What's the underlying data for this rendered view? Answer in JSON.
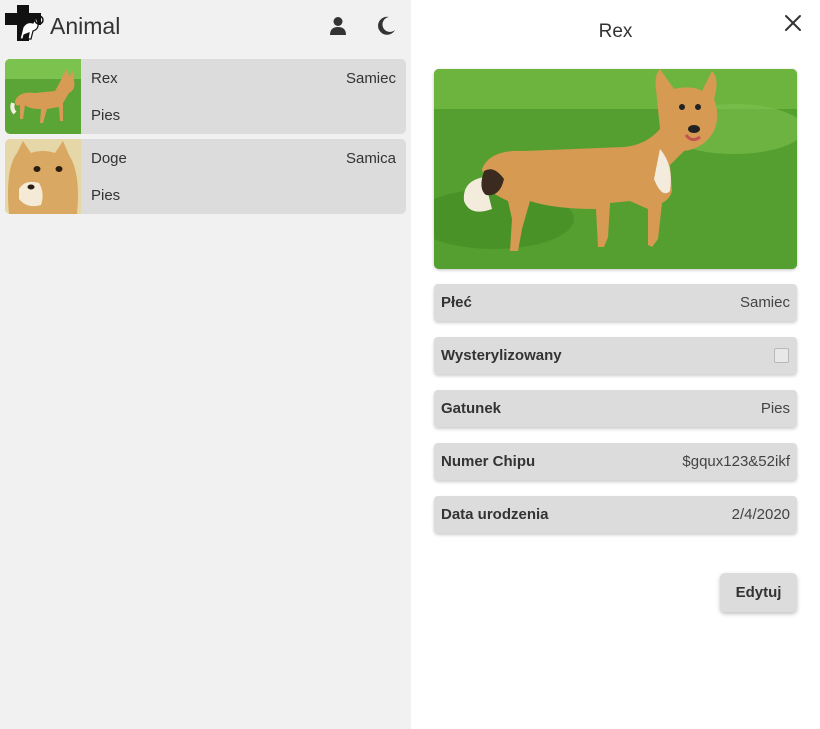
{
  "app": {
    "title": "Animal"
  },
  "header": {
    "icons": [
      "user-icon",
      "moon-icon"
    ]
  },
  "animals": [
    {
      "name": "Rex",
      "sex": "Samiec",
      "species": "Pies",
      "thumb_icon": "dog-photo"
    },
    {
      "name": "Doge",
      "sex": "Samica",
      "species": "Pies",
      "thumb_icon": "shiba-photo"
    }
  ],
  "detail": {
    "title": "Rex",
    "fields": [
      {
        "label": "Płeć",
        "value": "Samiec"
      },
      {
        "label": "Wysterylizowany",
        "checked": false
      },
      {
        "label": "Gatunek",
        "value": "Pies"
      },
      {
        "label": "Numer Chipu",
        "value": "$gqux123&52ikf"
      },
      {
        "label": "Data urodzenia",
        "value": "2/4/2020"
      }
    ],
    "edit_label": "Edytuj"
  },
  "colors": {
    "panel_left": "#f1f1f1",
    "card": "#dcdcdc",
    "grass": "#4f9a2e",
    "dog": "#d79a52"
  }
}
